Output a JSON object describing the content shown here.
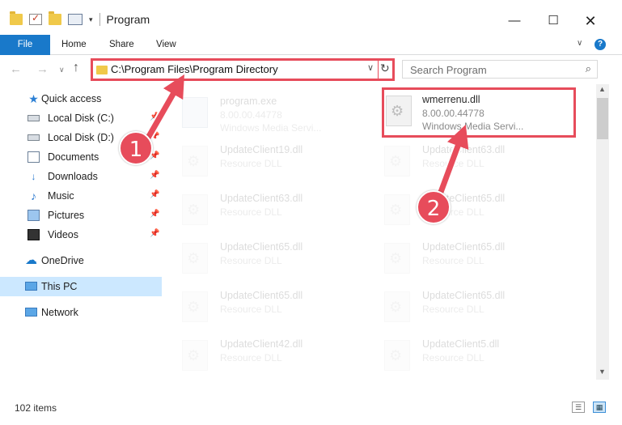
{
  "window": {
    "title": "Program",
    "minimize_glyph": "—",
    "maximize_glyph": "☐",
    "close_glyph": "✕"
  },
  "quick_access_toolbar": {
    "dropdown_glyph": "▾",
    "icons": [
      "folder-icon",
      "properties-check-icon",
      "new-folder-icon",
      "properties-icon"
    ]
  },
  "ribbon": {
    "tabs": [
      "File",
      "Home",
      "Share",
      "View"
    ],
    "expand_glyph": "∨",
    "help_glyph": "?"
  },
  "navigation": {
    "back_glyph": "←",
    "forward_glyph": "→",
    "recent_glyph": "∨",
    "up_glyph": "↑",
    "address": "C:\\Program Files\\Program Directory",
    "address_dropdown_glyph": "∨",
    "refresh_glyph": "↻",
    "search_placeholder": "Search Program",
    "search_glyph": "⌕"
  },
  "sidebar": {
    "items": [
      {
        "label": "Quick access",
        "icon": "star-icon",
        "pinned": false,
        "selected": false
      },
      {
        "label": "Local Disk (C:)",
        "icon": "disk-icon",
        "pinned": true,
        "selected": false
      },
      {
        "label": "Local Disk (D:)",
        "icon": "disk-icon",
        "pinned": true,
        "selected": false
      },
      {
        "label": "Documents",
        "icon": "documents-icon",
        "pinned": true,
        "selected": false
      },
      {
        "label": "Downloads",
        "icon": "downloads-icon",
        "pinned": true,
        "selected": false
      },
      {
        "label": "Music",
        "icon": "music-icon",
        "pinned": true,
        "selected": false
      },
      {
        "label": "Pictures",
        "icon": "pictures-icon",
        "pinned": true,
        "selected": false
      },
      {
        "label": "Videos",
        "icon": "videos-icon",
        "pinned": true,
        "selected": false
      },
      {
        "label": "OneDrive",
        "icon": "onedrive-icon",
        "pinned": false,
        "selected": false
      },
      {
        "label": "This PC",
        "icon": "this-pc-icon",
        "pinned": false,
        "selected": true
      },
      {
        "label": "Network",
        "icon": "network-icon",
        "pinned": false,
        "selected": false
      }
    ],
    "pin_glyph": "📌"
  },
  "files": [
    {
      "name": "program.exe",
      "version": "8.00.00.44778",
      "description": "Windows Media Servi...",
      "faded": true,
      "highlighted": false
    },
    {
      "name": "wmerrenu.dll",
      "version": "8.00.00.44778",
      "description": "Windows Media Servi...",
      "faded": false,
      "highlighted": true
    },
    {
      "name": "UpdateClient19.dll",
      "version": "Resource DLL",
      "description": "",
      "faded": true,
      "highlighted": false
    },
    {
      "name": "UpdateClient63.dll",
      "version": "Resource DLL",
      "description": "",
      "faded": true,
      "highlighted": false
    },
    {
      "name": "UpdateClient63.dll",
      "version": "Resource DLL",
      "description": "",
      "faded": true,
      "highlighted": false
    },
    {
      "name": "UpdateClient65.dll",
      "version": "Resource DLL",
      "description": "",
      "faded": true,
      "highlighted": false
    },
    {
      "name": "UpdateClient65.dll",
      "version": "Resource DLL",
      "description": "",
      "faded": true,
      "highlighted": false
    },
    {
      "name": "UpdateClient65.dll",
      "version": "Resource DLL",
      "description": "",
      "faded": true,
      "highlighted": false
    },
    {
      "name": "UpdateClient65.dll",
      "version": "Resource DLL",
      "description": "",
      "faded": true,
      "highlighted": false
    },
    {
      "name": "UpdateClient65.dll",
      "version": "Resource DLL",
      "description": "",
      "faded": true,
      "highlighted": false
    },
    {
      "name": "UpdateClient42.dll",
      "version": "Resource DLL",
      "description": "",
      "faded": true,
      "highlighted": false
    },
    {
      "name": "UpdateClient5.dll",
      "version": "Resource DLL",
      "description": "",
      "faded": true,
      "highlighted": false
    }
  ],
  "file_icon_glyph": "⚙",
  "scrollbar": {
    "up_glyph": "▲",
    "down_glyph": "▼"
  },
  "status": {
    "item_count": "102 items",
    "details_view_glyph": "☰",
    "tiles_view_glyph": "▦"
  },
  "annotations": {
    "badges": [
      "1",
      "2"
    ],
    "color": "#e74c5b"
  },
  "colors": {
    "accent": "#1979ca",
    "highlight": "#e74c5b",
    "selected_nav": "#cce8ff",
    "folder": "#f0c94a"
  }
}
